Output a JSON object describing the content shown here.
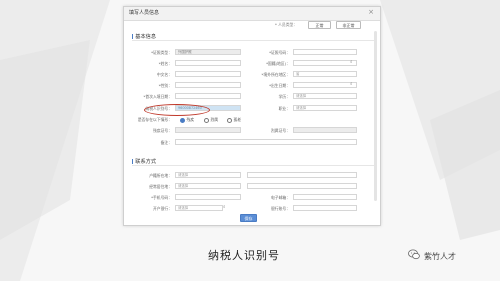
{
  "window": {
    "title": "填写人员信息"
  },
  "header": {
    "type_label": "* 人员类型：",
    "normal_btn": "正常",
    "abnormal_btn": "非正常"
  },
  "sections": {
    "basic": "基本信息",
    "contact": "联系方式"
  },
  "basic": {
    "id_type_label": "*证照类型：",
    "id_type_value": "外国护照",
    "id_number_label": "*证照号码：",
    "name_label": "*姓名：",
    "nationality_label": "*国籍(地区)：",
    "chinese_name_label": "中文名：",
    "birthplace_label": "*境外所在地区：",
    "birthplace_value": "省",
    "gender_label": "*性别：",
    "birthdate_label": "*出生日期：",
    "first_entry_label": "*首次入境日期：",
    "education_label": "学历：",
    "education_value": "请选择",
    "taxpayer_id_label": "纳税人识别号：",
    "taxpayer_id_value": "96000872460",
    "occupation_label": "职业：",
    "occupation_value": "请选择",
    "special_label": "是否存在以下情形：",
    "special_options": [
      "残疾",
      "烈属",
      "孤老"
    ],
    "employee_no_label": "残疾证号：",
    "martyr_no_label": "烈属证号：",
    "remark_label": "备注："
  },
  "contact": {
    "hukou_label": "户籍所在地：",
    "hukou_value": "请选择",
    "residence_label": "经常居住地：",
    "residence_value": "请选择",
    "mobile_label": "*手机号码：",
    "email_label": "电子邮箱：",
    "bank_label": "开户银行：",
    "bank_value": "请选择",
    "account_label": "银行账号："
  },
  "footer": {
    "save_btn": "保存"
  },
  "caption": "纳税人识别号",
  "brand": "紫竹人才",
  "colors": {
    "accent": "#4a7cc4",
    "highlight": "#c0392b"
  }
}
